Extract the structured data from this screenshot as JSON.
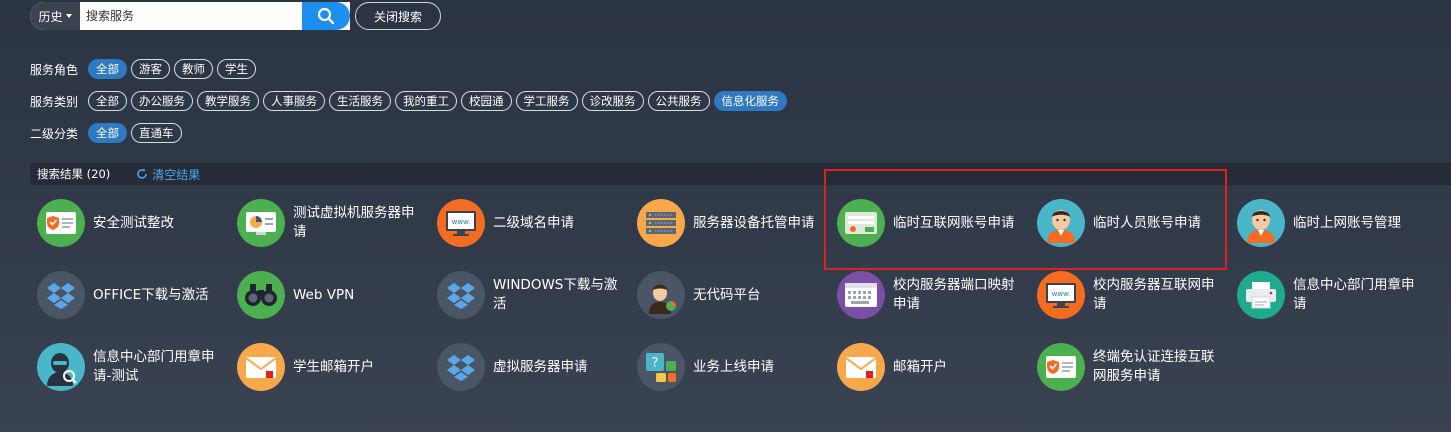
{
  "search": {
    "history_label": "历史",
    "placeholder": "搜索服务",
    "value": "",
    "close_label": "关闭搜索"
  },
  "filters": {
    "role": {
      "label": "服务角色",
      "options": [
        "全部",
        "游客",
        "教师",
        "学生"
      ],
      "active": "全部"
    },
    "category": {
      "label": "服务类别",
      "options": [
        "全部",
        "办公服务",
        "教学服务",
        "人事服务",
        "生活服务",
        "我的重工",
        "校园通",
        "学工服务",
        "诊改服务",
        "公共服务",
        "信息化服务"
      ],
      "active": "信息化服务"
    },
    "subcategory": {
      "label": "二级分类",
      "options": [
        "全部",
        "直通车"
      ],
      "active": "全部"
    }
  },
  "results": {
    "count_label": "搜索结果 (20)",
    "clear_label": "清空结果",
    "items": [
      {
        "label": "安全测试整改",
        "icon": "security-certificate-icon",
        "color": "#4caf50"
      },
      {
        "label": "测试虚拟机服务器申请",
        "icon": "server-chart-icon",
        "color": "#4caf50"
      },
      {
        "label": "二级域名申请",
        "icon": "www-monitor-icon",
        "color": "#f36c21"
      },
      {
        "label": "服务器设备托管申请",
        "icon": "server-rack-icon",
        "color": "#f7a84a"
      },
      {
        "label": "临时互联网账号申请",
        "icon": "login-account-icon",
        "color": "#4caf50"
      },
      {
        "label": "临时人员账号申请",
        "icon": "person-avatar-icon",
        "color": "#49b7c9"
      },
      {
        "label": "临时上网账号管理",
        "icon": "person-avatar-icon",
        "color": "#49b7c9"
      },
      {
        "label": "OFFICE下载与激活",
        "icon": "dropbox-icon",
        "color": "#4a5566"
      },
      {
        "label": "Web VPN",
        "icon": "binoculars-icon",
        "color": "#4caf50"
      },
      {
        "label": "WINDOWS下载与激活",
        "icon": "dropbox-icon",
        "color": "#4a5566"
      },
      {
        "label": "无代码平台",
        "icon": "presenter-icon",
        "color": "#4a5566"
      },
      {
        "label": "校内服务器端口映射申请",
        "icon": "keyboard-window-icon",
        "color": "#7b4fa8"
      },
      {
        "label": "校内服务器互联网申请",
        "icon": "www-monitor-icon",
        "color": "#f36c21"
      },
      {
        "label": "信息中心部门用章申请",
        "icon": "printer-icon",
        "color": "#1eaa8f"
      },
      {
        "label": "信息中心部门用章申请-测试",
        "icon": "hacker-search-icon",
        "color": "#49b7c9"
      },
      {
        "label": "学生邮箱开户",
        "icon": "mail-envelope-icon",
        "color": "#f7a84a"
      },
      {
        "label": "虚拟服务器申请",
        "icon": "dropbox-icon",
        "color": "#4a5566"
      },
      {
        "label": "业务上线申请",
        "icon": "help-tiles-icon",
        "color": "#4a5566"
      },
      {
        "label": "邮箱开户",
        "icon": "mail-envelope-icon",
        "color": "#f7a84a"
      },
      {
        "label": "终端免认证连接互联网服务申请",
        "icon": "security-certificate-icon",
        "color": "#4caf50"
      }
    ]
  },
  "colors": {
    "accent": "#1e8ef0",
    "chip_active": "#2e79bf",
    "highlight": "#e02020",
    "link": "#4ea3ee"
  }
}
